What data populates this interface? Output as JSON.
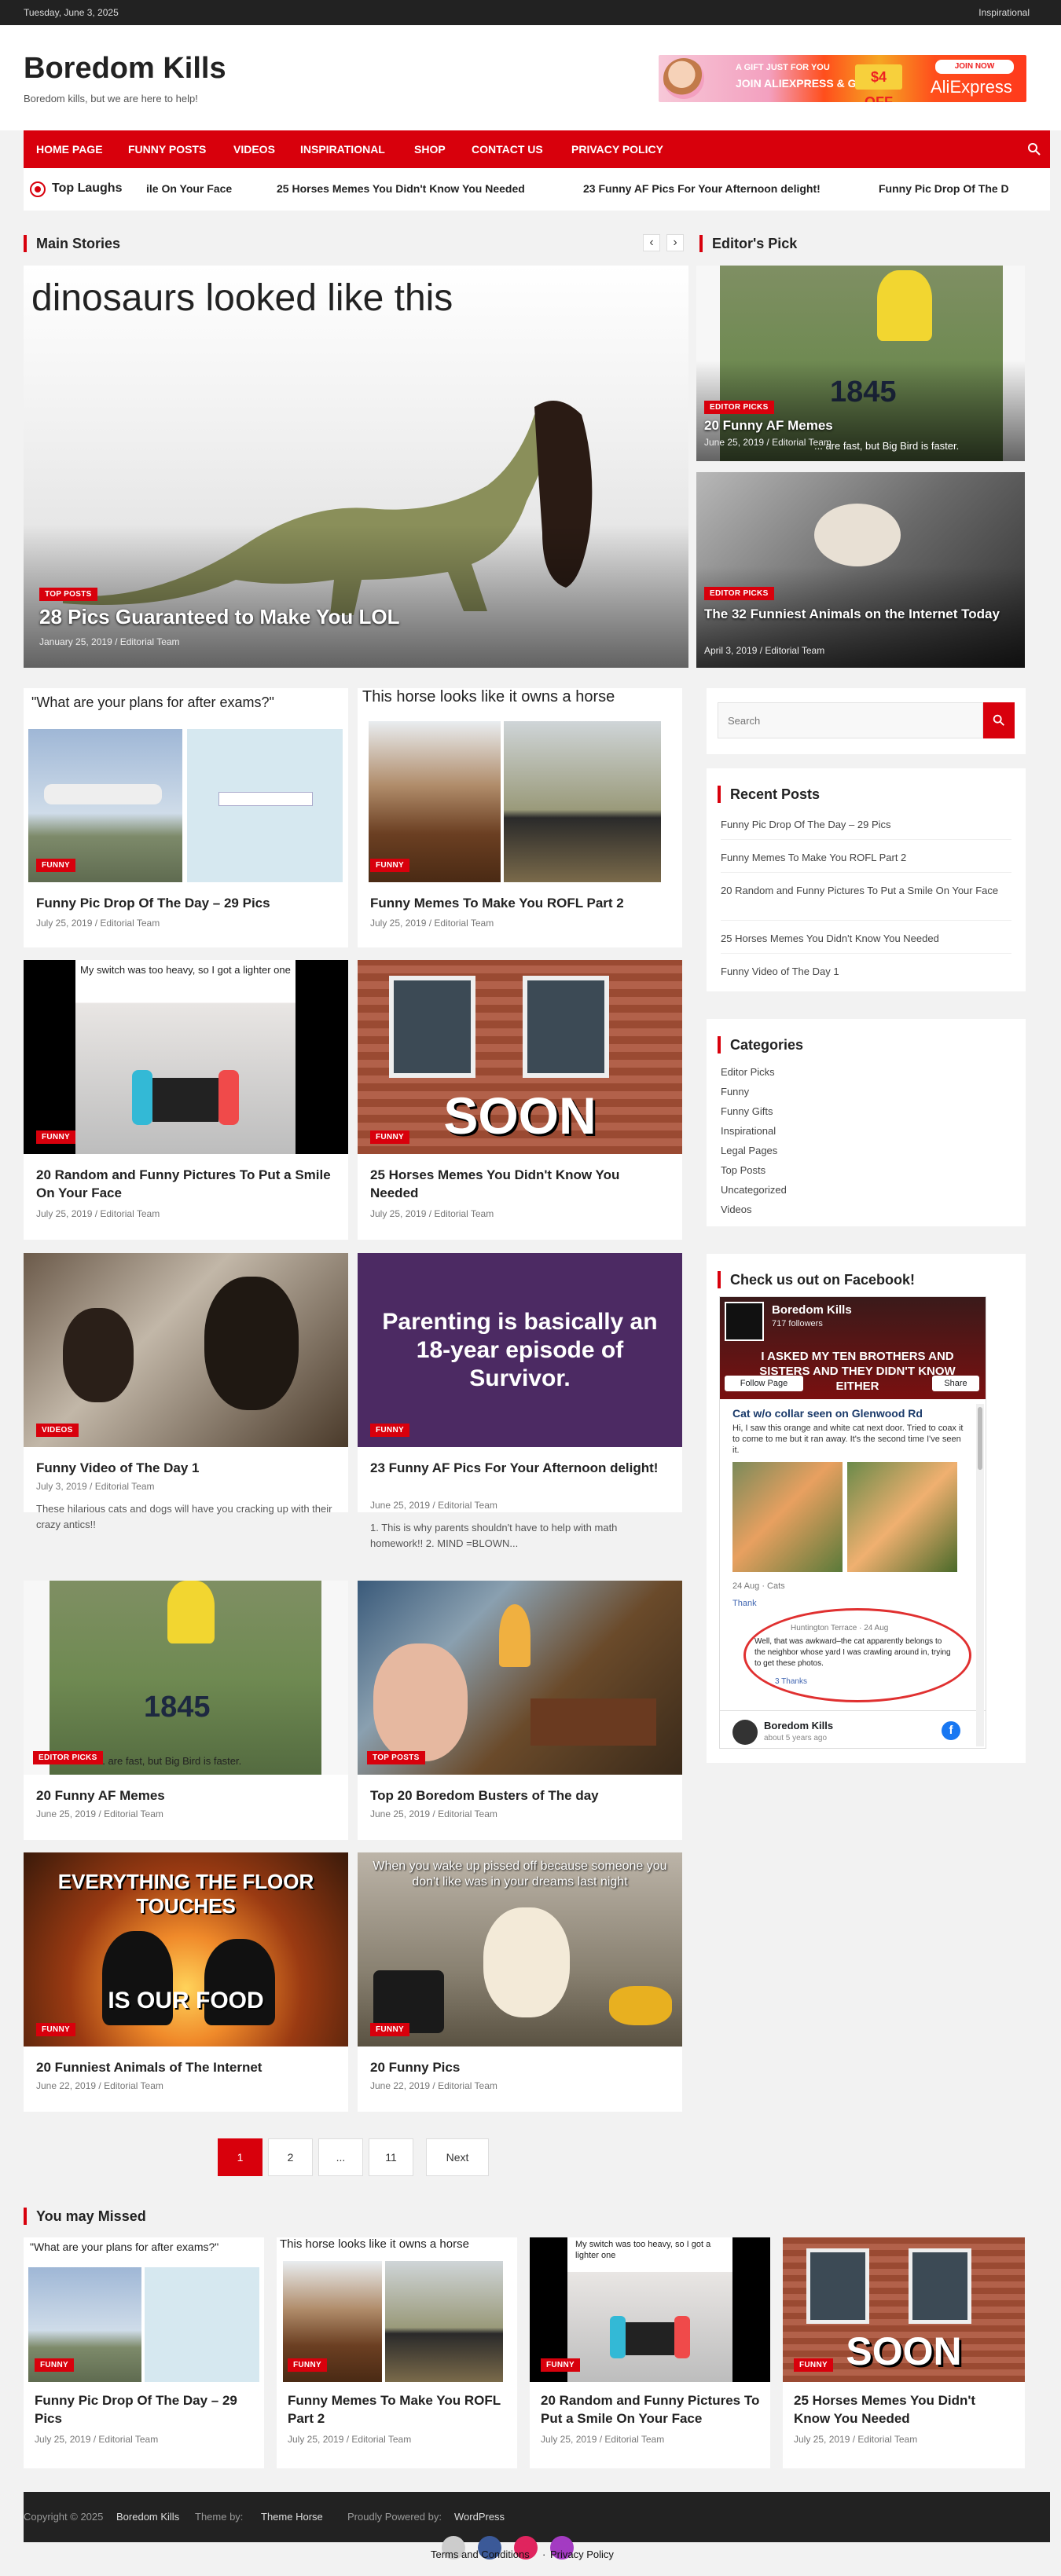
{
  "topbar": {
    "date": "Tuesday, June 3, 2025",
    "tag": "Inspirational"
  },
  "header": {
    "title": "Boredom Kills",
    "description": "Boredom kills, but we are here to help!",
    "ad": {
      "line1": "A GIFT JUST FOR YOU",
      "line2": "JOIN ALIEXPRESS & GET",
      "offer": "$4 OFF",
      "cta": "JOIN NOW",
      "brand": "AliExpress"
    }
  },
  "nav": {
    "items": [
      "HOME PAGE",
      "FUNNY POSTS",
      "VIDEOS",
      "INSPIRATIONAL",
      "SHOP",
      "CONTACT US",
      "PRIVACY POLICY"
    ]
  },
  "ticker": {
    "label": "Top Laughs",
    "items": [
      "ile On Your Face",
      "25 Horses Memes You Didn't Know You Needed",
      "23 Funny AF Pics For Your Afternoon delight!",
      "Funny Pic Drop Of The D"
    ]
  },
  "main_stories": {
    "title": "Main Stories",
    "feature": {
      "caption": "dinosaurs looked like this",
      "badge": "TOP POSTS",
      "title": "28 Pics Guaranteed to Make You LOL",
      "meta": "January 25, 2019 / Editorial Team"
    }
  },
  "editors_pick": {
    "title": "Editor's Pick",
    "items": [
      {
        "badge": "EDITOR PICKS",
        "title": "20 Funny AF Memes",
        "meta": "June 25, 2019 / Editorial Team",
        "number": "1845",
        "caption": "... are fast, but Big Bird is faster."
      },
      {
        "badge": "EDITOR PICKS",
        "title": "The 32 Funniest Animals on the Internet Today",
        "meta": "April 3, 2019 / Editorial Team"
      }
    ]
  },
  "posts": [
    {
      "badge": "FUNNY",
      "title": "Funny Pic Drop Of The Day – 29 Pics",
      "meta": "July 25, 2019 / Editorial Team",
      "caption": "\"What are your plans for after exams?\"",
      "excerpt": ""
    },
    {
      "badge": "FUNNY",
      "title": "Funny Memes To Make You ROFL Part 2",
      "meta": "July 25, 2019 / Editorial Team",
      "caption": "This horse looks like it owns a horse",
      "excerpt": ""
    },
    {
      "badge": "FUNNY",
      "title": "20 Random and Funny Pictures To Put a Smile On Your Face",
      "meta": "July 25, 2019 / Editorial Team",
      "caption": "My switch was too heavy, so I got a lighter one",
      "excerpt": ""
    },
    {
      "badge": "FUNNY",
      "title": "25 Horses Memes You Didn't Know You Needed",
      "meta": "July 25, 2019 / Editorial Team",
      "caption": "SOON",
      "excerpt": ""
    },
    {
      "badge": "VIDEOS",
      "title": "Funny Video of The Day 1",
      "meta": "July 3, 2019 / Editorial Team",
      "caption": "",
      "excerpt": "These hilarious cats and dogs will have you cracking up with their crazy antics!!"
    },
    {
      "badge": "FUNNY",
      "title": "23 Funny AF Pics For Your Afternoon delight!",
      "meta": "June 25, 2019 / Editorial Team",
      "caption": "Parenting is basically an 18-year episode of Survivor.",
      "excerpt": "1. This is why parents shouldn't have to help with math homework!!   2. MIND =BLOWN..."
    },
    {
      "badge": "EDITOR PICKS",
      "title": "20 Funny AF Memes",
      "meta": "June 25, 2019 / Editorial Team",
      "caption": "... are fast, but Big Bird is faster.",
      "number": "1845",
      "excerpt": ""
    },
    {
      "badge": "TOP POSTS",
      "title": "Top 20 Boredom Busters of The day",
      "meta": "June 25, 2019 / Editorial Team",
      "caption": "",
      "excerpt": ""
    },
    {
      "badge": "FUNNY",
      "title": "20 Funniest Animals of The Internet",
      "meta": "June 22, 2019 / Editorial Team",
      "caption": "EVERYTHING THE FLOOR TOUCHES",
      "caption2": "IS OUR FOOD",
      "excerpt": ""
    },
    {
      "badge": "FUNNY",
      "title": "20 Funny Pics",
      "meta": "June 22, 2019 / Editorial Team",
      "caption": "When you wake up pissed off because someone you don't like was in your dreams last night",
      "excerpt": ""
    }
  ],
  "pagination": {
    "pages": [
      "1",
      "2",
      "...",
      "11",
      "Next"
    ]
  },
  "sidebar": {
    "search_placeholder": "Search",
    "recent_title": "Recent Posts",
    "recent": [
      "Funny Pic Drop Of The Day – 29 Pics",
      "Funny Memes To Make You ROFL Part 2",
      "20 Random and Funny Pictures To Put a Smile On Your Face",
      "25 Horses Memes You Didn't Know You Needed",
      "Funny Video of The Day 1"
    ],
    "categories_title": "Categories",
    "categories": [
      "Editor Picks",
      "Funny",
      "Funny Gifts",
      "Inspirational",
      "Legal Pages",
      "Top Posts",
      "Uncategorized",
      "Videos"
    ],
    "facebook_title": "Check us out on Facebook!",
    "facebook": {
      "page_name": "Boredom Kills",
      "followers": "717 followers",
      "follow": "Follow Page",
      "share": "Share",
      "banner": "I ASKED MY TEN BROTHERS AND SISTERS AND THEY DIDN'T KNOW EITHER",
      "post_title": "Cat w/o collar seen on Glenwood Rd",
      "post_text": "Hi, I saw this orange and white cat next door. Tried to coax it to come to me but it ran away. It's the second time I've seen it.",
      "post_meta": "24 Aug · Cats",
      "thank": "Thank",
      "reply_meta": "Huntington Terrace · 24 Aug",
      "reply_text": "Well, that was awkward–the cat apparently belongs to the neighbor whose yard I was crawling around in, trying to get these photos.",
      "reply_thanks": "3 Thanks",
      "footer_name": "Boredom Kills",
      "footer_time": "about 5 years ago"
    }
  },
  "missed": {
    "title": "You may Missed",
    "items": [
      {
        "badge": "FUNNY",
        "title": "Funny Pic Drop Of The Day – 29 Pics",
        "meta": "July 25, 2019 / Editorial Team",
        "caption": "\"What are your plans for after exams?\""
      },
      {
        "badge": "FUNNY",
        "title": "Funny Memes To Make You ROFL Part 2",
        "meta": "July 25, 2019 / Editorial Team",
        "caption": "This horse looks like it owns a horse"
      },
      {
        "badge": "FUNNY",
        "title": "20 Random and Funny Pictures To Put a Smile On Your Face",
        "meta": "July 25, 2019 / Editorial Team",
        "caption": "My switch was too heavy, so I got a lighter one"
      },
      {
        "badge": "FUNNY",
        "title": "25 Horses Memes You Didn't Know You Needed",
        "meta": "July 25, 2019 / Editorial Team",
        "caption": "SOON"
      }
    ]
  },
  "footer": {
    "copyright": "Copyright © 2025",
    "site": "Boredom Kills",
    "theme_by": "Theme by:",
    "theme": "Theme Horse",
    "powered": "Proudly Powered by:",
    "wp": "WordPress",
    "legal1": "Terms and Conditions",
    "legal_sep": "·",
    "legal2": "Privacy Policy"
  },
  "colors": {
    "accent": "#d8000c",
    "dark": "#222222"
  }
}
